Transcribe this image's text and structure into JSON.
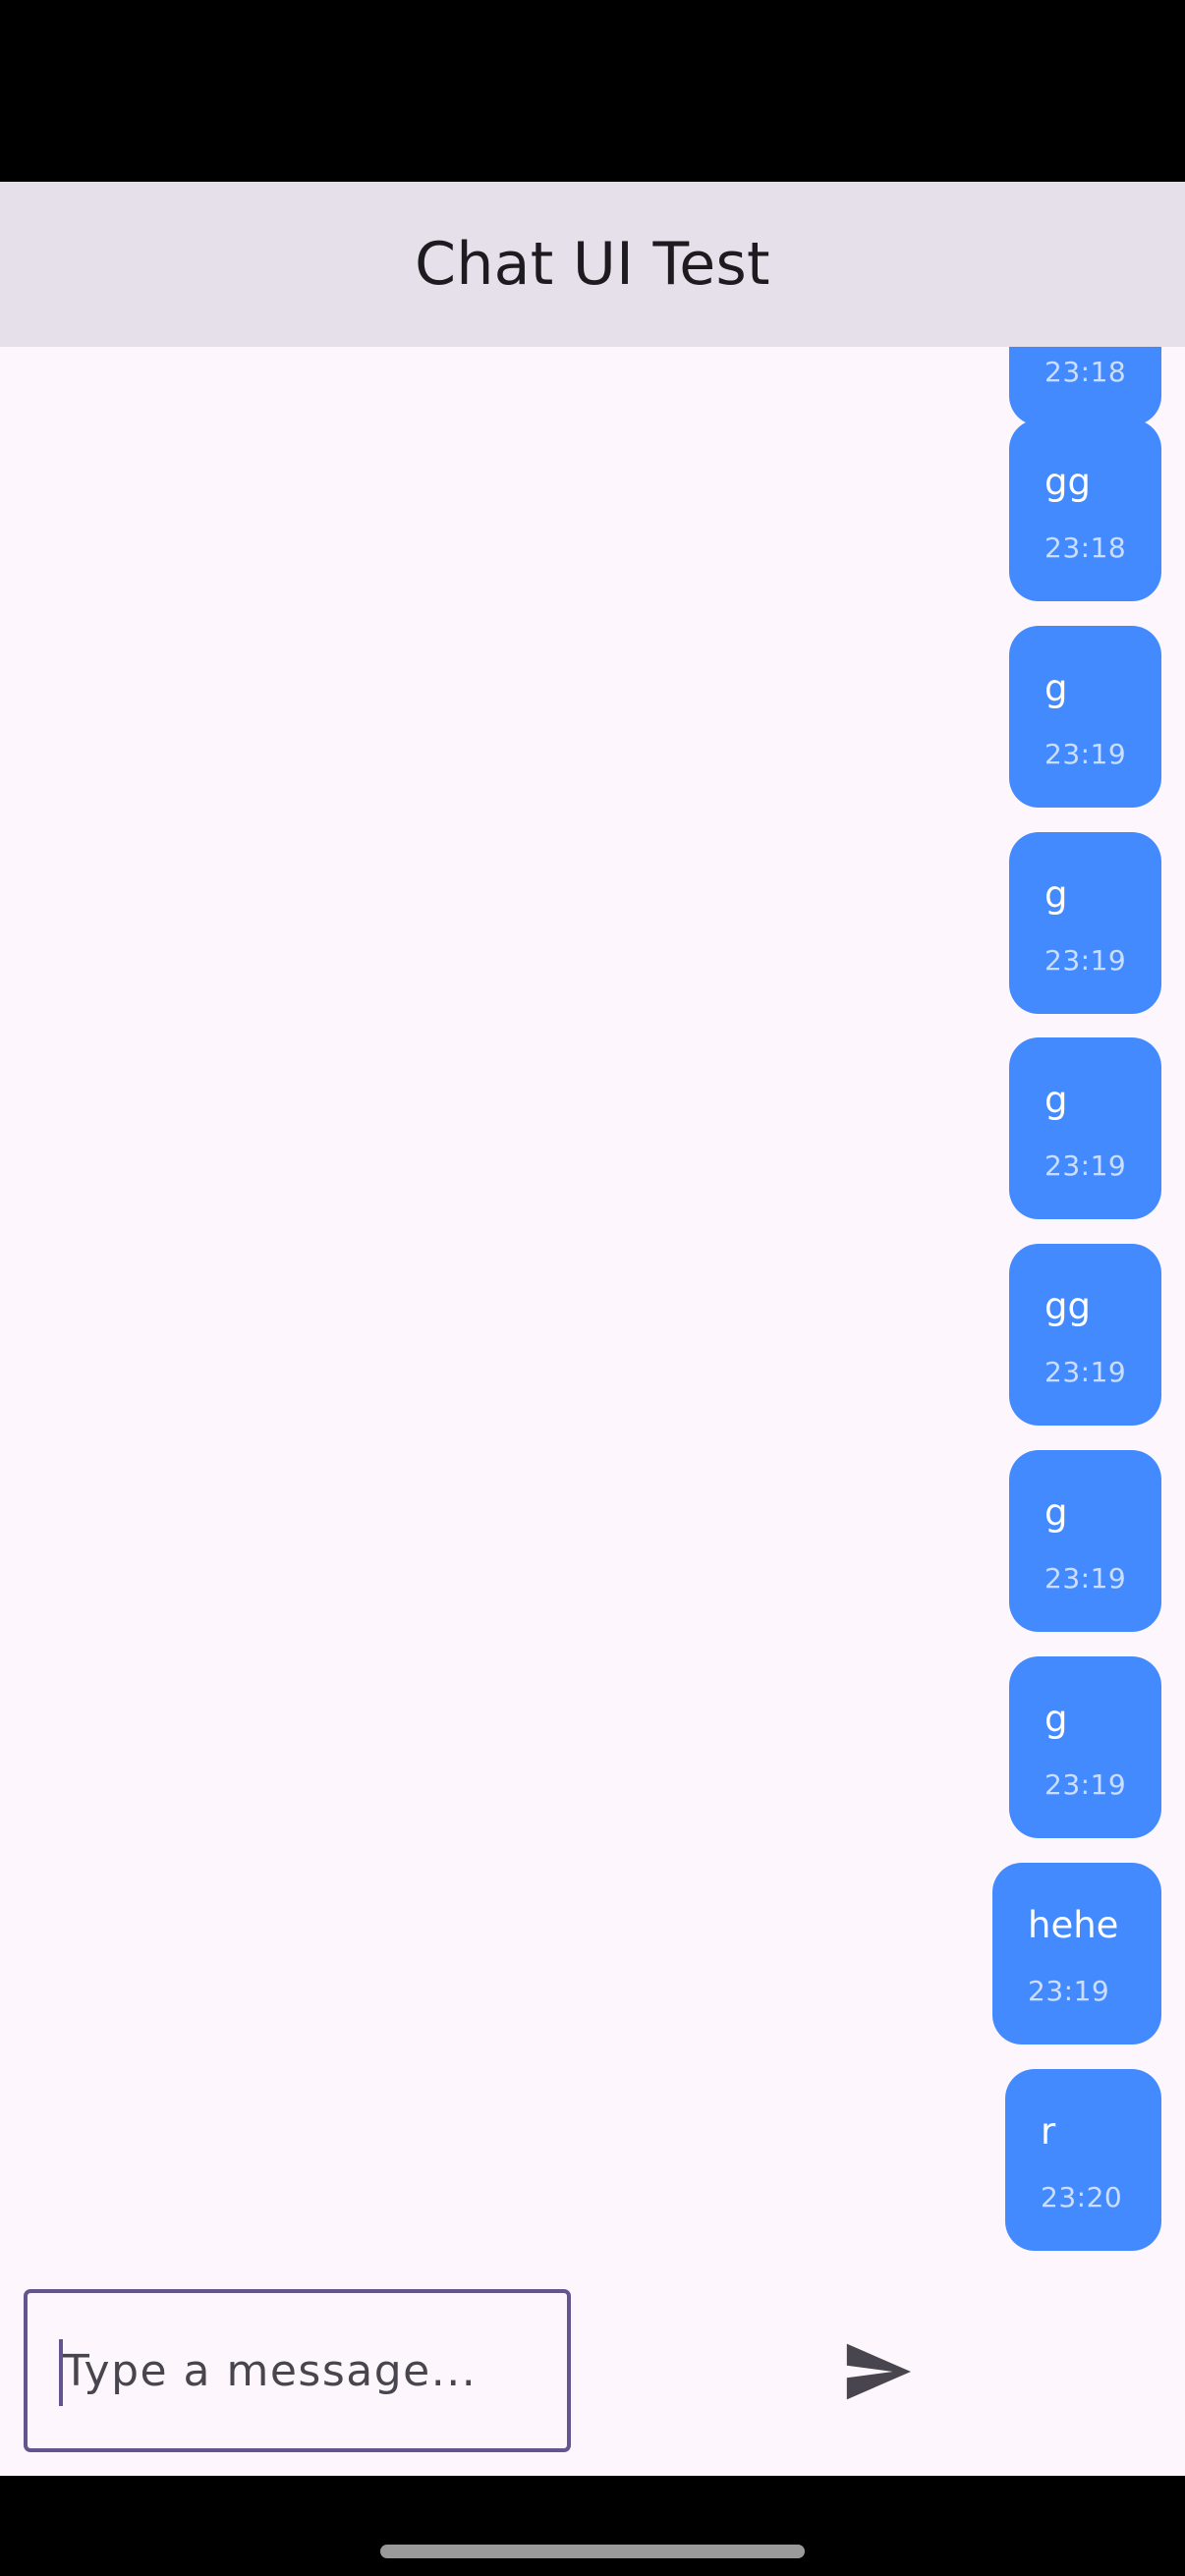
{
  "app_bar": {
    "title": "Chat UI Test"
  },
  "messages": [
    {
      "text": "",
      "time": "23:18"
    },
    {
      "text": "gg",
      "time": "23:18"
    },
    {
      "text": "g",
      "time": "23:19"
    },
    {
      "text": "g",
      "time": "23:19"
    },
    {
      "text": "g",
      "time": "23:19"
    },
    {
      "text": "gg",
      "time": "23:19"
    },
    {
      "text": "g",
      "time": "23:19"
    },
    {
      "text": "g",
      "time": "23:19"
    },
    {
      "text": "hehe",
      "time": "23:19"
    },
    {
      "text": "r",
      "time": "23:20"
    }
  ],
  "composer": {
    "placeholder": "Type a message...",
    "value": "",
    "send_icon": "send-icon"
  },
  "colors": {
    "app_bar": "#E6E0EB",
    "background": "#FDF7FD",
    "bubble": "#448AFF",
    "input_border": "#65558F"
  }
}
